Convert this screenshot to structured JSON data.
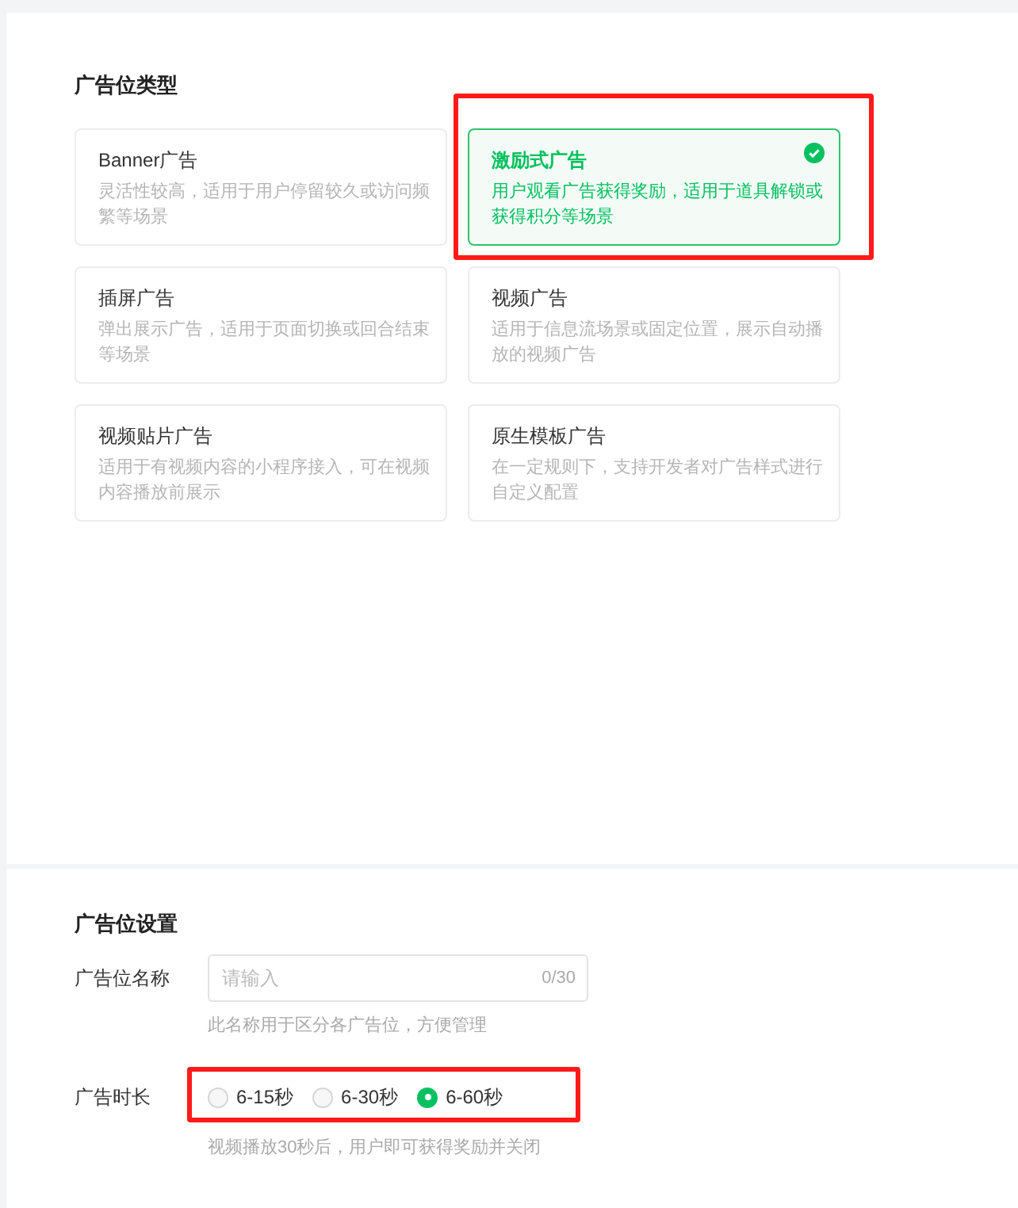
{
  "type_section": {
    "title": "广告位类型",
    "cards": [
      {
        "title": "Banner广告",
        "description": "灵活性较高，适用于用户停留较久或访问频繁等场景",
        "selected": false,
        "highlighted": false
      },
      {
        "title": "激励式广告",
        "description": "用户观看广告获得奖励，适用于道具解锁或获得积分等场景",
        "selected": true,
        "highlighted": true
      },
      {
        "title": "插屏广告",
        "description": "弹出展示广告，适用于页面切换或回合结束等场景",
        "selected": false,
        "highlighted": false
      },
      {
        "title": "视频广告",
        "description": "适用于信息流场景或固定位置，展示自动播放的视频广告",
        "selected": false,
        "highlighted": false
      },
      {
        "title": "视频贴片广告",
        "description": "适用于有视频内容的小程序接入，可在视频内容播放前展示",
        "selected": false,
        "highlighted": false
      },
      {
        "title": "原生模板广告",
        "description": "在一定规则下，支持开发者对广告样式进行自定义配置",
        "selected": false,
        "highlighted": false
      }
    ]
  },
  "settings_section": {
    "title": "广告位设置",
    "name_field": {
      "label": "广告位名称",
      "placeholder": "请输入",
      "counter": "0/30",
      "hint": "此名称用于区分各广告位，方便管理"
    },
    "duration": {
      "label": "广告时长",
      "highlighted": true,
      "options": [
        {
          "label": "6-15秒",
          "selected": false
        },
        {
          "label": "6-30秒",
          "selected": false
        },
        {
          "label": "6-60秒",
          "selected": true
        }
      ],
      "hint": "视频播放30秒后，用户即可获得奖励并关闭"
    }
  }
}
